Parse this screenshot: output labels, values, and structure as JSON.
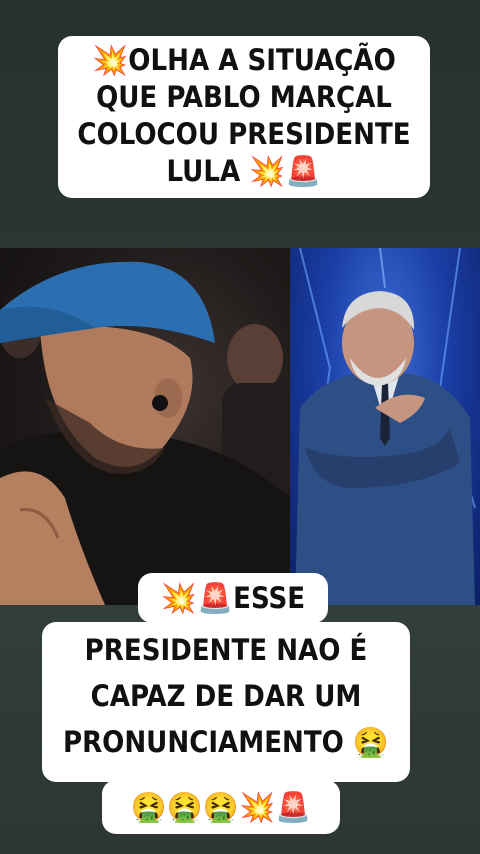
{
  "top_caption": {
    "lines": [
      "💥OLHA A SITUAÇÃO",
      "QUE PABLO MARÇAL",
      "COLOCOU PRESIDENTE",
      "LULA 💥🚨"
    ]
  },
  "bottom_caption": {
    "line1": "💥🚨ESSE",
    "line2": "PRESIDENTE NAO É",
    "line3": "CAPAZ DE DAR UM",
    "line4": "PRONUNCIAMENTO 🤮",
    "line5": "🤮🤮🤮💥🚨"
  }
}
